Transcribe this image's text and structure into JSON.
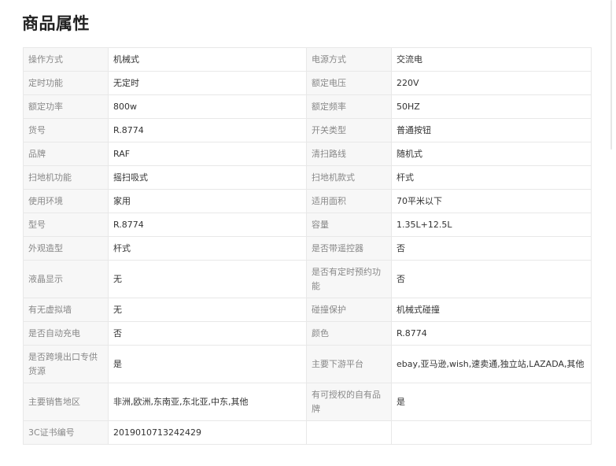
{
  "page": {
    "title": "商品属性"
  },
  "attributes": {
    "rows": [
      {
        "label1": "操作方式",
        "value1": "机械式",
        "label2": "电源方式",
        "value2": "交流电"
      },
      {
        "label1": "定时功能",
        "value1": "无定时",
        "label2": "额定电压",
        "value2": "220V"
      },
      {
        "label1": "额定功率",
        "value1": "800w",
        "label2": "额定频率",
        "value2": "50HZ"
      },
      {
        "label1": "货号",
        "value1": "R.8774",
        "label2": "开关类型",
        "value2": "普通按钮"
      },
      {
        "label1": "品牌",
        "value1": "RAF",
        "label2": "清扫路线",
        "value2": "随机式"
      },
      {
        "label1": "扫地机功能",
        "value1": "摇扫吸式",
        "label2": "扫地机款式",
        "value2": "杆式"
      },
      {
        "label1": "使用环境",
        "value1": "家用",
        "label2": "适用面积",
        "value2": "70平米以下"
      },
      {
        "label1": "型号",
        "value1": "R.8774",
        "label2": "容量",
        "value2": "1.35L+12.5L"
      },
      {
        "label1": "外观造型",
        "value1": "杆式",
        "label2": "是否带遥控器",
        "value2": "否"
      },
      {
        "label1": "液晶显示",
        "value1": "无",
        "label2": "是否有定时预约功能",
        "value2": "否"
      },
      {
        "label1": "有无虚拟墙",
        "value1": "无",
        "label2": "碰撞保护",
        "value2": "机械式碰撞"
      },
      {
        "label1": "是否自动充电",
        "value1": "否",
        "label2": "颜色",
        "value2": "R.8774"
      },
      {
        "label1": "是否跨境出口专供货源",
        "value1": "是",
        "label2": "主要下游平台",
        "value2": "ebay,亚马逊,wish,速卖通,独立站,LAZADA,其他"
      },
      {
        "label1": "主要销售地区",
        "value1": "非洲,欧洲,东南亚,东北亚,中东,其他",
        "label2": "有可授权的自有品牌",
        "value2": "是"
      },
      {
        "label1": "3C证书编号",
        "value1": "2019010713242429",
        "label2": "",
        "value2": ""
      }
    ]
  }
}
